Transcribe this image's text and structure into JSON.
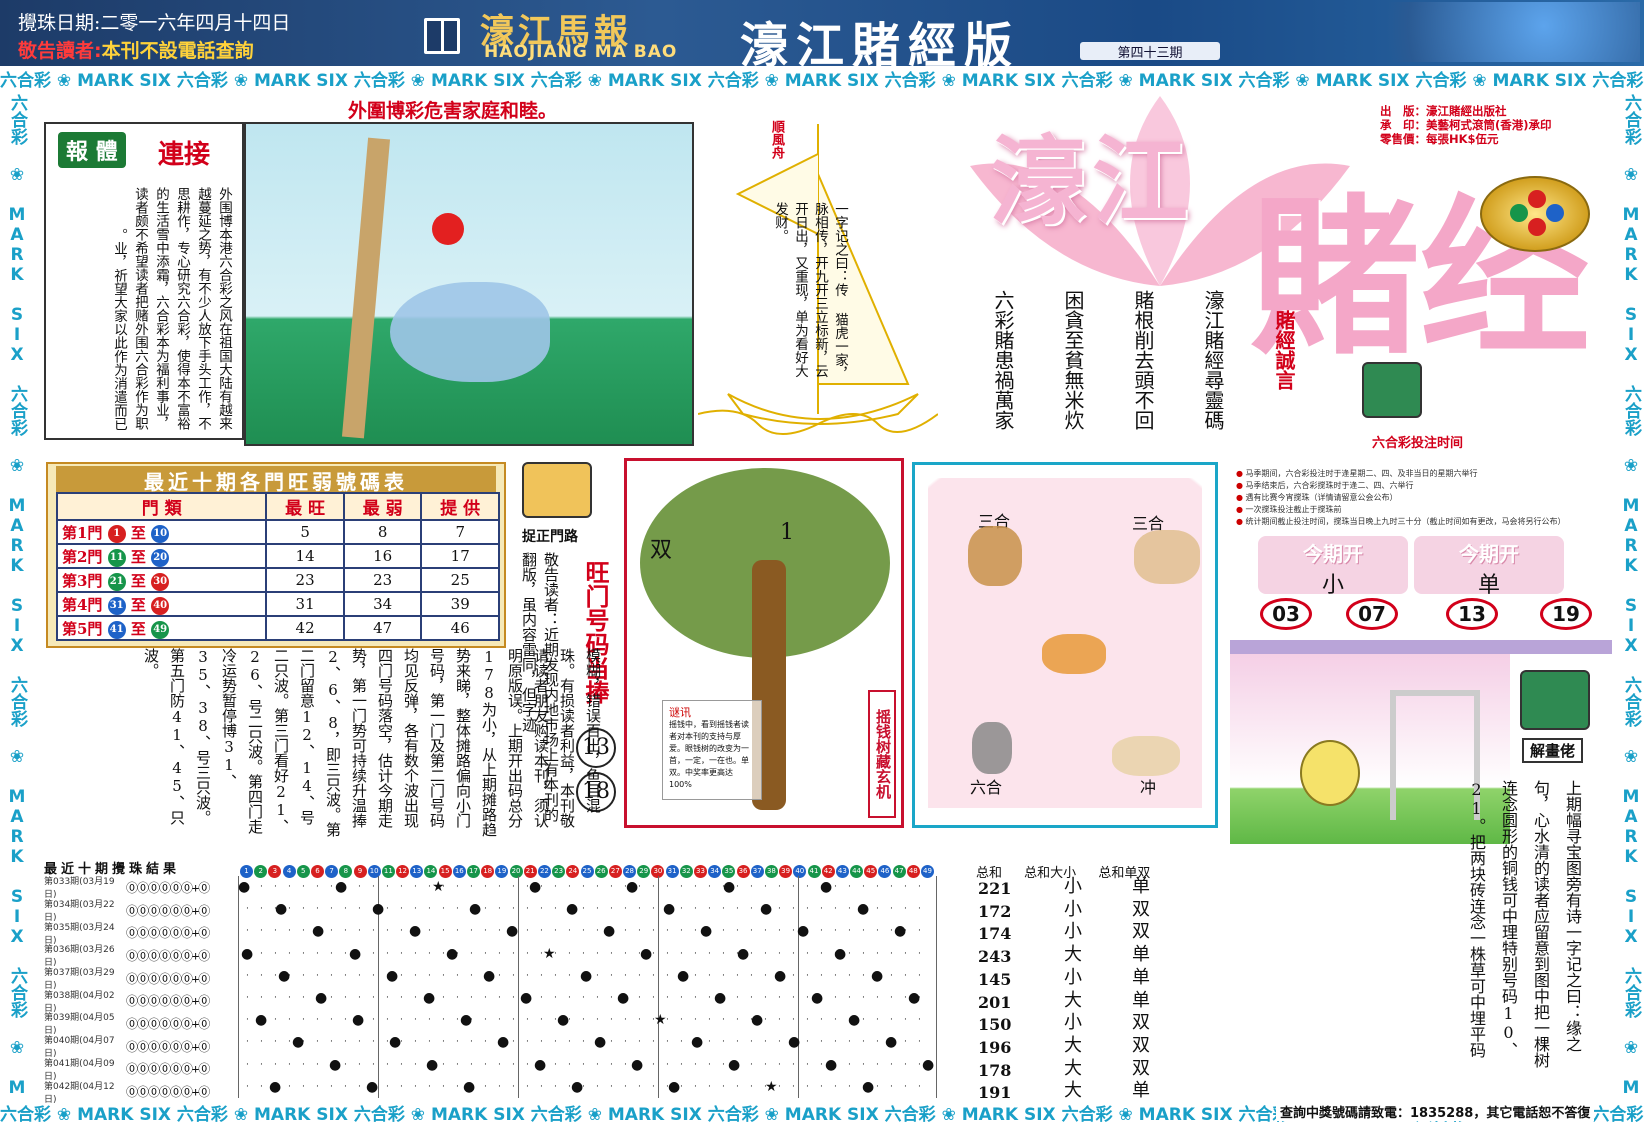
{
  "header": {
    "date": "攪珠日期:二零一六年四月十四日",
    "notice_prefix": "敬告讀者:",
    "notice": "本刊不設電話查詢",
    "brand": "濠江馬報",
    "brand_en": "HAOJIANG MA BAO",
    "edition": "濠江賭經版",
    "issue": "第四十三期"
  },
  "strip_text": "六合彩 ❀ MARK SIX 六合彩 ❀ MARK SIX 六合彩 ❀ MARK SIX 六合彩 ❀ MARK SIX 六合彩 ❀ MARK SIX 六合彩 ❀ MARK SIX 六合彩 ❀ MARK SIX 六合彩 ❀ MARK SIX 六合彩 ❀ MARK SIX 六合彩 ❀ MARK SIX",
  "side_text": "六合彩 ❀ MARK SIX 六合彩 ❀ MARK SIX 六合彩 ❀ MARK SIX 六合彩 ❀ MARK SIX 六合彩 ❀ MARK SIX 六合彩 ❀ MARK SIX 六合彩 ❀ MARK SIX",
  "outside": {
    "headline": "外圍博彩危害家庭和睦。",
    "report_badge": "報 體",
    "report_title": "連接",
    "report_text": "外围博本港六合彩之风在祖国大陆有越来越蔓延之势，有不少人放下手头工作，不思耕作，专心研究六合彩，使得本不富裕的生活雪中添霜，六合彩本为福利事业，读者颇不希望读者把赌外围六合彩作为职业，祈望大家以此作为消遣而已。"
  },
  "sail": {
    "flag": "順風舟",
    "text": "一字记之曰：传 猫虎一家，脉相传，开九开三立标新，云开日出，又重现，单为看好大发财。"
  },
  "poem": [
    "六彩賭患禍萬家",
    "困貪至貧無米炊",
    "賭根削去頭不回",
    "濠江賭經尋靈碼"
  ],
  "motto": "賭經誠言",
  "title_big": "濠江",
  "title_big2": "賭经",
  "pub_info": [
    "出　版：濠江賭經出版社",
    "承　印：美藝柯式滾筒(香港)承印",
    "零售價：每張HK$伍元"
  ],
  "lhc": {
    "title": "六合彩投注时间",
    "lines": [
      "马季期间，六合彩投注时于逢星期二、四、及非当日的星期六举行",
      "马季结束后，六合彩搅珠时于逢二、四、六举行",
      "遇有比赛今宵搅珠（详情请留意公会公布）",
      "一次搅珠投注截止于搅珠前",
      "统计期间截止投注时间，搅珠当日晚上九时三十分（截止时间如有更改，马会将另行公布）"
    ]
  },
  "table": {
    "title": "最近十期各門旺弱號碼表",
    "headers": [
      "門 類",
      "最 旺",
      "最 弱",
      "提 供"
    ],
    "rows": [
      {
        "door": "第1門",
        "a": "1",
        "b": "10",
        "c1": "dr",
        "c2": "db",
        "hot": "5",
        "cold": "8",
        "give": "7"
      },
      {
        "door": "第2門",
        "a": "11",
        "b": "20",
        "c1": "dg",
        "c2": "db",
        "hot": "14",
        "cold": "16",
        "give": "17"
      },
      {
        "door": "第3門",
        "a": "21",
        "b": "30",
        "c1": "dg",
        "c2": "dr",
        "hot": "23",
        "cold": "23",
        "give": "25"
      },
      {
        "door": "第4門",
        "a": "31",
        "b": "40",
        "c1": "db",
        "c2": "dr",
        "hot": "31",
        "cold": "34",
        "give": "39"
      },
      {
        "door": "第5門",
        "a": "41",
        "b": "49",
        "c1": "db",
        "c2": "dg",
        "hot": "42",
        "cold": "47",
        "give": "46"
      }
    ],
    "to": "至"
  },
  "zhuo": {
    "label": "捉正門路",
    "text": "敬告读者：近期发现内地市场上有本刊的翻版，虽内容雷同，但字迹",
    "wang": "旺门号码当捧",
    "n1": "13",
    "n2": "18"
  },
  "long_text": "模糊，错误百出，鱼目混珠。有损读者利益，本刊敬请读者朋友购读本刊，须认明原版误。上期开出码总分178为小，从上期摊路趋势来睇，整体摊路偏向小门号码，第一门及第二门号码均见反弹，各有数个波出现四门号码落空，估计今期走势，第一门势可持续升温捧2、6、8，即三只波。第二门留意12、14、号二只波。第三门看好21、26、号二只波。第四门走冷运势暂停博31、35、38、号三只波。第五门防41、45、只波。",
  "tree": {
    "shuang": "双",
    "yi": "1",
    "label": "摇钱树藏玄机",
    "note_title": "谜讯",
    "note": "摇钱中，看到摇钱者读者对本刊的支持与厚爱。眼钱树的改变为一首，一定，一在也。单双。中奖率更高达100%"
  },
  "zodiac": {
    "tl": "三合",
    "tr": "三合",
    "bl": "六合",
    "br": "冲"
  },
  "kai": {
    "t1": "今期开",
    "v1": "小",
    "t2": "今期开",
    "v2": "单",
    "nums": [
      "03",
      "07",
      "13",
      "19"
    ]
  },
  "jiehua": {
    "label": "解畫佬",
    "text": "上期幅寻宝图旁有诗一字记之曰：缘之句，心水清的读者应留意到图中把一棵树连念圆形的铜钱可中理特别号码10、21。把两块砖连念一株草可中埋平码"
  },
  "results": {
    "title": "最近十期攪珠結果",
    "rows": [
      {
        "name": "第033期(03月19日)"
      },
      {
        "name": "第034期(03月22日)"
      },
      {
        "name": "第035期(03月24日)"
      },
      {
        "name": "第036期(03月26日)"
      },
      {
        "name": "第037期(03月29日)"
      },
      {
        "name": "第038期(04月02日)"
      },
      {
        "name": "第039期(04月05日)"
      },
      {
        "name": "第040期(04月07日)"
      },
      {
        "name": "第041期(04月09日)"
      },
      {
        "name": "第042期(04月12日)"
      }
    ],
    "balls_glyph": "⓪⓪⓪⓪⓪⓪+⓪"
  },
  "sum": {
    "head": [
      "总和",
      "总和大小",
      "总和单双"
    ],
    "totals": [
      "221",
      "172",
      "174",
      "243",
      "145",
      "201",
      "150",
      "196",
      "178",
      "191"
    ],
    "dx": [
      "小",
      "小",
      "小",
      "大",
      "小",
      "大",
      "小",
      "大",
      "大",
      "大"
    ],
    "ds": [
      "单",
      "双",
      "双",
      "单",
      "单",
      "单",
      "双",
      "双",
      "双",
      "单"
    ]
  },
  "contact": "查詢中獎號碼請致電：1835288，其它電話恕不答復"
}
